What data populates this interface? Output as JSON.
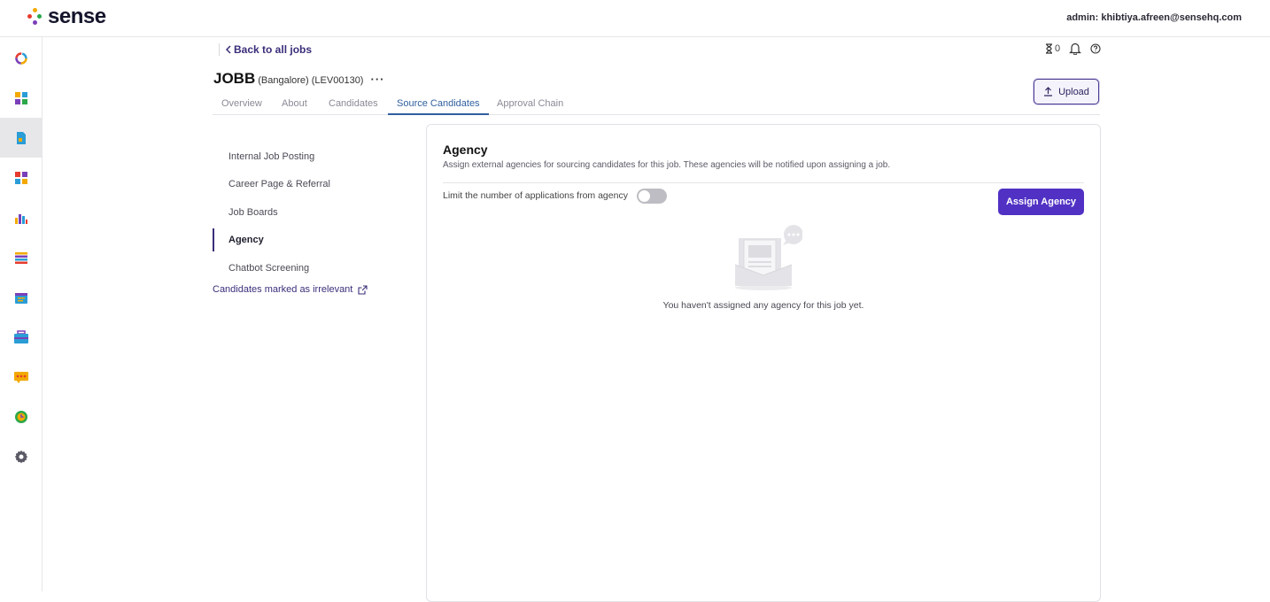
{
  "brand": {
    "name": "sense"
  },
  "header": {
    "admin_label": "admin: khibtiya.afreen@sensehq.com"
  },
  "sidebar": {
    "items": [
      {
        "icon": "ring-chart-icon"
      },
      {
        "icon": "dashboard-grid-icon"
      },
      {
        "icon": "document-icon",
        "active": true
      },
      {
        "icon": "puzzle-icon"
      },
      {
        "icon": "bar-chart-icon"
      },
      {
        "icon": "list-icon"
      },
      {
        "icon": "calendar-icon"
      },
      {
        "icon": "briefcase-icon"
      },
      {
        "icon": "chat-bubble-icon"
      },
      {
        "icon": "clock-icon"
      },
      {
        "icon": "gear-icon"
      }
    ]
  },
  "nav": {
    "back_label": "Back to all jobs",
    "hourglass_count": "0"
  },
  "job": {
    "name": "JOBB",
    "meta": "(Bangalore) (LEV00130)",
    "more": "···"
  },
  "actions": {
    "upload_label": "Upload"
  },
  "tabs": [
    {
      "label": "Overview"
    },
    {
      "label": "About"
    },
    {
      "label": "Candidates"
    },
    {
      "label": "Source Candidates",
      "active": true
    },
    {
      "label": "Approval Chain"
    }
  ],
  "subnav": {
    "items": [
      {
        "label": "Internal Job Posting"
      },
      {
        "label": "Career Page & Referral"
      },
      {
        "label": "Job Boards"
      },
      {
        "label": "Agency",
        "active": true
      },
      {
        "label": "Chatbot Screening"
      }
    ],
    "irrelevant_link": "Candidates marked as irrelevant"
  },
  "agency": {
    "title": "Agency",
    "description": "Assign external agencies for sourcing candidates for this job. These agencies will be notified upon assigning a job.",
    "limit_label": "Limit the number of applications from agency",
    "limit_enabled": false,
    "assign_button": "Assign Agency",
    "empty_text": "You haven't assigned any agency for this job yet."
  },
  "colors": {
    "accent": "#5131c4",
    "tab_active": "#2f5f9e",
    "link": "#3b2d7a"
  }
}
